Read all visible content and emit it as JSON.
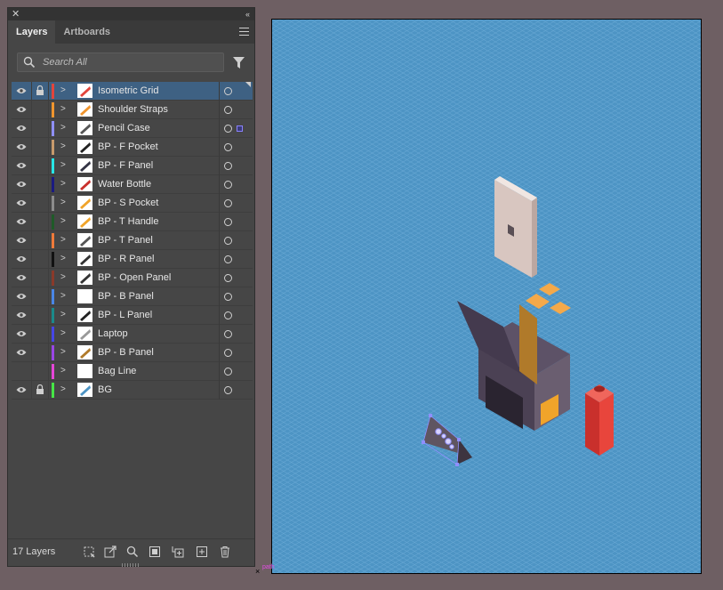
{
  "panel": {
    "tabs": [
      {
        "label": "Layers",
        "active": true
      },
      {
        "label": "Artboards",
        "active": false
      }
    ],
    "search": {
      "placeholder": "Search All"
    },
    "layers": [
      {
        "name": "Isometric Grid",
        "color": "#e2453c",
        "visible": true,
        "locked": true,
        "selected": true
      },
      {
        "name": "Shoulder Straps",
        "color": "#f0952e",
        "visible": true,
        "locked": false
      },
      {
        "name": "Pencil Case",
        "color": "#8f8fff",
        "visible": true,
        "locked": false,
        "has_selection": true
      },
      {
        "name": "BP - F Pocket",
        "color": "#c89a6c",
        "visible": true,
        "locked": false
      },
      {
        "name": "BP - F Panel",
        "color": "#28e6e6",
        "visible": true,
        "locked": false
      },
      {
        "name": "Water Bottle",
        "color": "#1a1a80",
        "visible": true,
        "locked": false
      },
      {
        "name": "BP - S Pocket",
        "color": "#8c8c8c",
        "visible": true,
        "locked": false
      },
      {
        "name": "BP - T Handle",
        "color": "#1f5a28",
        "visible": true,
        "locked": false
      },
      {
        "name": "BP - T Panel",
        "color": "#f07a3a",
        "visible": true,
        "locked": false
      },
      {
        "name": "BP - R Panel",
        "color": "#111111",
        "visible": true,
        "locked": false
      },
      {
        "name": "BP - Open Panel",
        "color": "#8a3a2a",
        "visible": true,
        "locked": false
      },
      {
        "name": "BP - B Panel",
        "color": "#4a86e6",
        "visible": true,
        "locked": false
      },
      {
        "name": "BP - L Panel",
        "color": "#1a8a8a",
        "visible": true,
        "locked": false
      },
      {
        "name": "Laptop",
        "color": "#4646e6",
        "visible": true,
        "locked": false
      },
      {
        "name": "BP - B Panel",
        "color": "#9a46e6",
        "visible": true,
        "locked": false
      },
      {
        "name": "Bag Line",
        "color": "#e646d8",
        "visible": false,
        "locked": false
      },
      {
        "name": "BG",
        "color": "#46e646",
        "visible": true,
        "locked": true
      }
    ],
    "footer": {
      "layer_count": "17 Layers"
    }
  },
  "artboard": {
    "background": "#4d94c4",
    "selection_label": "path"
  }
}
